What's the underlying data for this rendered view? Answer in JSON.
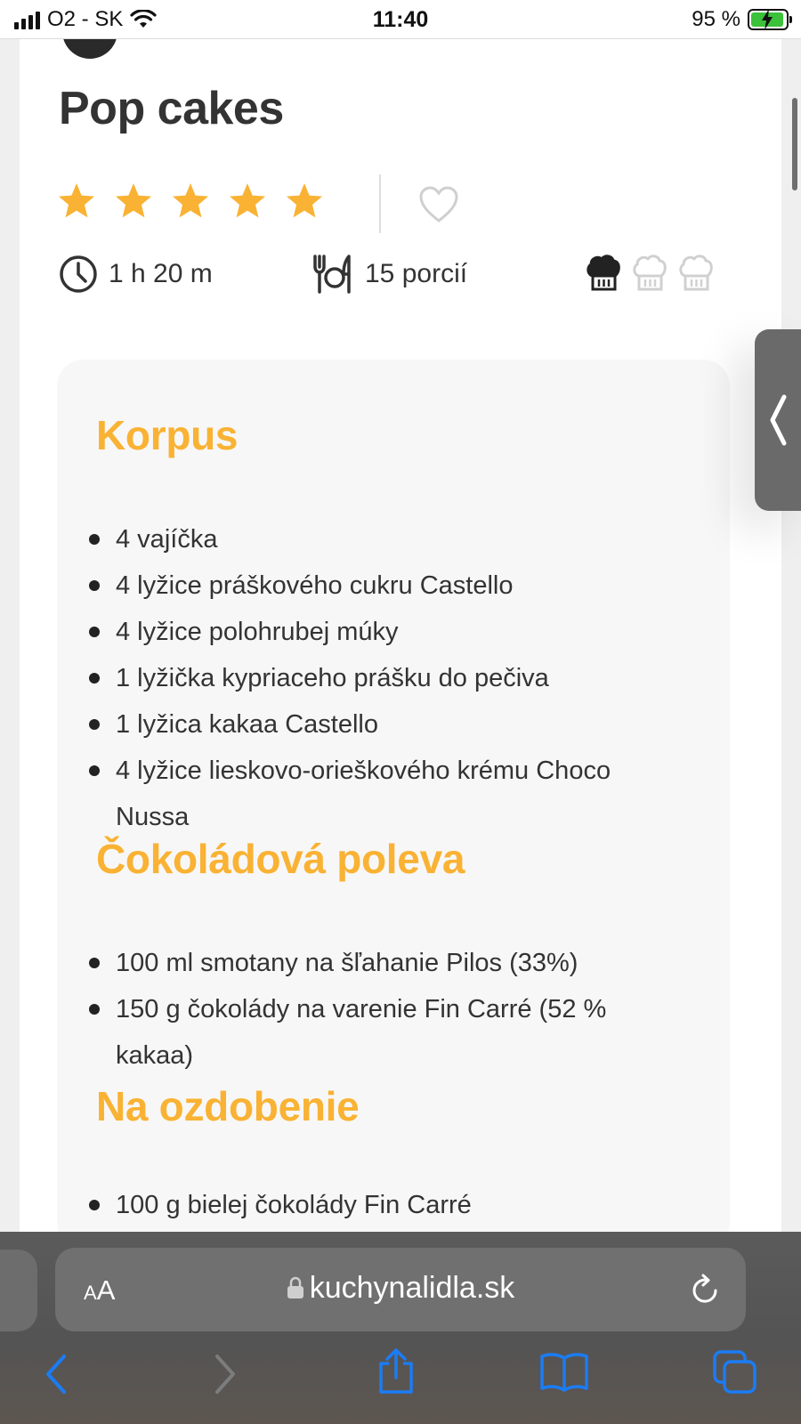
{
  "status_bar": {
    "carrier": "O2 - SK",
    "time": "11:40",
    "battery_percent": "95 %",
    "battery_level": 0.95,
    "icons": [
      "signal-icon",
      "wifi-icon",
      "battery-charging-icon"
    ]
  },
  "recipe": {
    "title": "Pop cakes",
    "rating": 5,
    "rating_max": 5,
    "time": "1 h 20 m",
    "servings": "15 porcií",
    "difficulty": 1,
    "difficulty_max": 3
  },
  "ingredients": {
    "sections": [
      {
        "title": "Korpus",
        "items": [
          "4 vajíčka",
          "4 lyžice práškového cukru Castello",
          "4 lyžice polohrubej múky",
          "1 lyžička kypriaceho prášku do pečiva",
          "1 lyžica kakaa Castello",
          "4 lyžice lieskovo-orieškového krému Choco Nussa"
        ]
      },
      {
        "title": "Čokoládová poleva",
        "items": [
          "100 ml smotany na šľahanie Pilos (33%)",
          "150 g čokolády na varenie Fin Carré (52 % kakaa)"
        ]
      },
      {
        "title": "Na ozdobenie",
        "items": [
          "100 g bielej čokolády Fin Carré"
        ]
      }
    ]
  },
  "browser": {
    "aa_small": "A",
    "aa_big": "A",
    "domain": "kuchynalidla.sk"
  },
  "colors": {
    "accent": "#f9b233",
    "ios_blue": "#1b7cf5",
    "text": "#333333"
  }
}
